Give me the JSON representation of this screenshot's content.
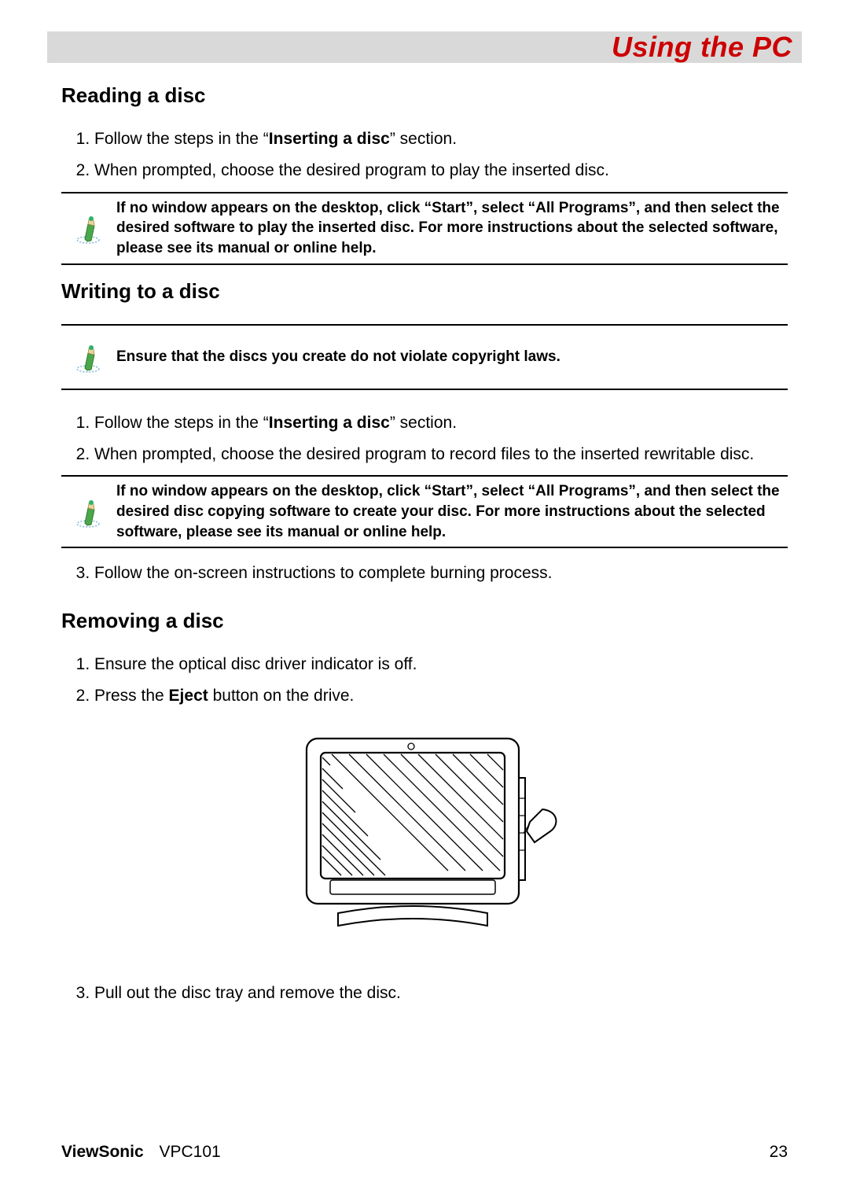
{
  "header": {
    "title": "Using the PC"
  },
  "sections": {
    "reading": {
      "title": "Reading a disc",
      "step1_pre": "Follow the steps in the “",
      "step1_bold": "Inserting a disc",
      "step1_post": "” section.",
      "step2": "When prompted, choose the desired program to play the inserted disc.",
      "note": "If no window appears on the desktop, click “Start”, select “All Programs”, and then select the desired software to play the inserted disc. For more instructions about the selected software, please see its manual or online help."
    },
    "writing": {
      "title": "Writing to a disc",
      "note1": "Ensure that the discs you create do not violate copyright laws.",
      "step1_pre": "Follow the steps in the “",
      "step1_bold": "Inserting a disc",
      "step1_post": "” section.",
      "step2": "When prompted, choose the desired program to record files to the inserted rewritable disc.",
      "note2": "If no window appears on the desktop, click “Start”, select “All Programs”, and then select the desired disc copying software to create your disc. For more instructions about the selected software, please see its manual or online help.",
      "step3": "Follow the on-screen instructions to complete burning process."
    },
    "removing": {
      "title": "Removing a disc",
      "step1": "Ensure the optical disc driver indicator is off.",
      "step2_pre": "Press the ",
      "step2_bold": "Eject",
      "step2_post": " button on the drive.",
      "step3": "Pull out the disc tray and remove the disc."
    }
  },
  "footer": {
    "brand": "ViewSonic",
    "model": "VPC101",
    "page": "23"
  }
}
